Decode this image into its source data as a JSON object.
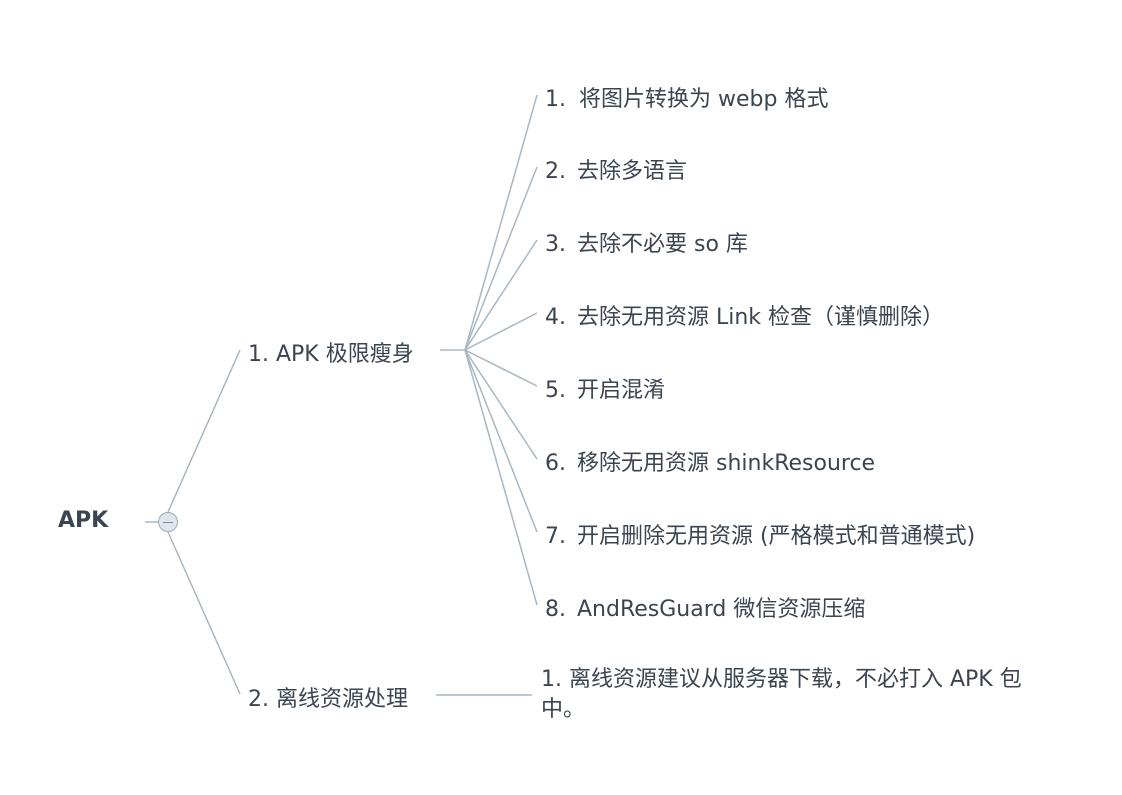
{
  "mindmap": {
    "root": {
      "label": "APK"
    },
    "branches": [
      {
        "label": "1. APK 极限瘦身",
        "children": [
          {
            "num": "1.",
            "text": "将图片转换为 webp 格式"
          },
          {
            "num": "2.",
            "text": "去除多语言"
          },
          {
            "num": "3.",
            "text": "去除不必要 so 库"
          },
          {
            "num": "4.",
            "text": "去除无用资源 Link 检查（谨慎删除）"
          },
          {
            "num": "5.",
            "text": "开启混淆"
          },
          {
            "num": "6.",
            "text": "移除无用资源 shinkResource"
          },
          {
            "num": "7.",
            "text": "开启删除无用资源 (严格模式和普通模式)"
          },
          {
            "num": "8.",
            "text": "AndResGuard 微信资源压缩"
          }
        ]
      },
      {
        "label": "2. 离线资源处理",
        "children": [
          {
            "text": "1. 离线资源建议从服务器下载，不必打入 APK 包中。"
          }
        ]
      }
    ],
    "colors": {
      "line": "#a9b7c4",
      "text": "#3b4451",
      "toggle_fill": "#dfe6ec"
    }
  }
}
